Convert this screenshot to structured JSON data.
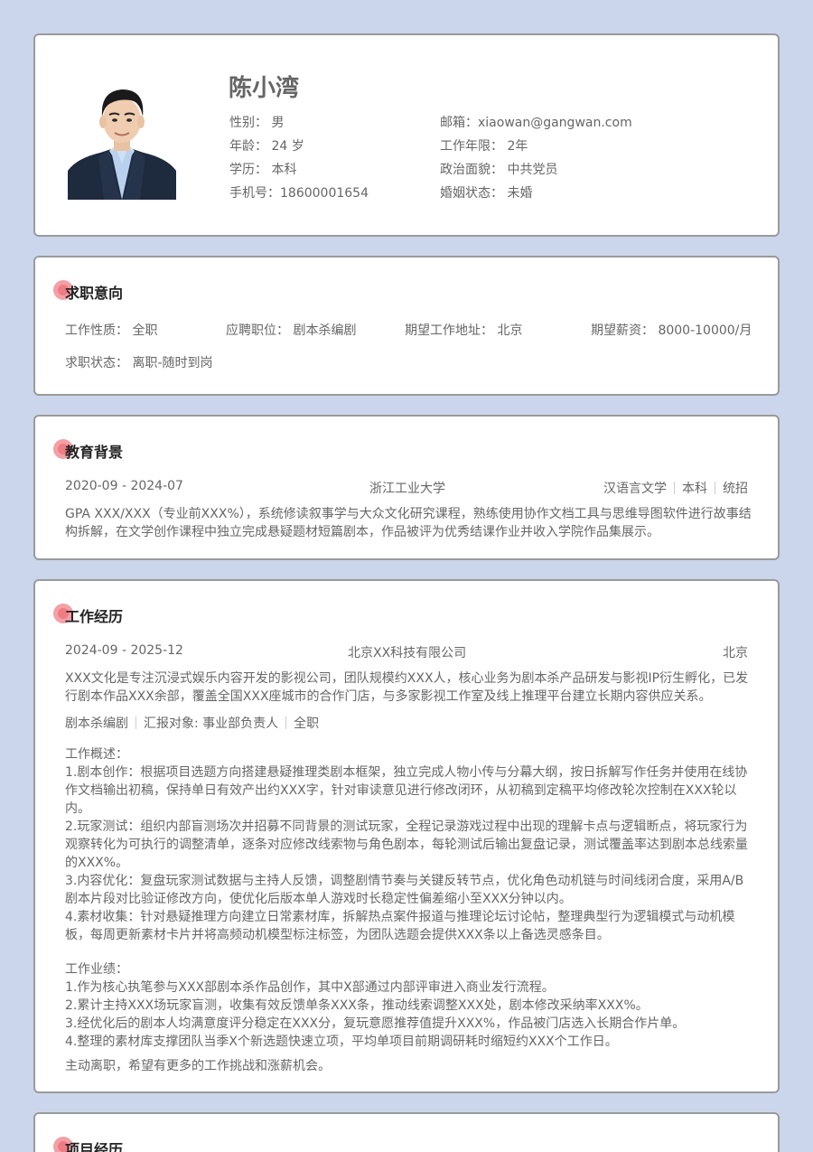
{
  "profile": {
    "name": "陈小湾",
    "gender_label": "性别：",
    "gender": "男",
    "age_label": "年龄：",
    "age": "24 岁",
    "edu_label": "学历：",
    "edu": "本科",
    "phone_label": "手机号：",
    "phone": "18600001654",
    "email_label": "邮箱：",
    "email": "xiaowan@gangwan.com",
    "years_label": "工作年限：",
    "years": "2年",
    "politics_label": "政治面貌：",
    "politics": "中共党员",
    "marital_label": "婚姻状态：",
    "marital": "未婚"
  },
  "intent": {
    "title": "求职意向",
    "type_label": "工作性质：",
    "type": "全职",
    "position_label": "应聘职位：",
    "position": "剧本杀编剧",
    "location_label": "期望工作地址：",
    "location": "北京",
    "salary_label": "期望薪资：",
    "salary": "8000-10000/月",
    "status_label": "求职状态：",
    "status": "离职-随时到岗"
  },
  "education": {
    "title": "教育背景",
    "period": "2020-09 - 2024-07",
    "school": "浙江工业大学",
    "major": "汉语言文学",
    "degree": "本科",
    "mode": "统招",
    "desc": "GPA XXX/XXX（专业前XXX%），系统修读叙事学与大众文化研究课程，熟练使用协作文档工具与思维导图软件进行故事结构拆解，在文学创作课程中独立完成悬疑题材短篇剧本，作品被评为优秀结课作业并收入学院作品集展示。"
  },
  "work": {
    "title": "工作经历",
    "period": "2024-09 - 2025-12",
    "company": "北京XX科技有限公司",
    "city": "北京",
    "company_desc": "XXX文化是专注沉浸式娱乐内容开发的影视公司，团队规模约XXX人，核心业务为剧本杀产品研发与影视IP衍生孵化，已发行剧本作品XXX余部，覆盖全国XXX座城市的合作门店，与多家影视工作室及线上推理平台建立长期内容供应关系。",
    "role": "剧本杀编剧",
    "report": "汇报对象: 事业部负责人",
    "job_type": "全职",
    "overview_label": "工作概述：",
    "overview": [
      "1.剧本创作：根据项目选题方向搭建悬疑推理类剧本框架，独立完成人物小传与分幕大纲，按日拆解写作任务并使用在线协作文档输出初稿，保持单日有效产出约XXX字，针对审读意见进行修改闭环，从初稿到定稿平均修改轮次控制在XXX轮以内。",
      "2.玩家测试：组织内部盲测场次并招募不同背景的测试玩家，全程记录游戏过程中出现的理解卡点与逻辑断点，将玩家行为观察转化为可执行的调整清单，逐条对应修改线索物与角色剧本，每轮测试后输出复盘记录，测试覆盖率达到剧本总线索量的XXX%。",
      "3.内容优化：复盘玩家测试数据与主持人反馈，调整剧情节奏与关键反转节点，优化角色动机链与时间线闭合度，采用A/B剧本片段对比验证修改方向，使优化后版本单人游戏时长稳定性偏差缩小至XXX分钟以内。",
      "4.素材收集：针对悬疑推理方向建立日常素材库，拆解热点案件报道与推理论坛讨论帖，整理典型行为逻辑模式与动机模板，每周更新素材卡片并将高频动机模型标注标签，为团队选题会提供XXX条以上备选灵感条目。"
    ],
    "results_label": "工作业绩：",
    "results": [
      "1.作为核心执笔参与XXX部剧本杀作品创作，其中X部通过内部评审进入商业发行流程。",
      "2.累计主持XXX场玩家盲测，收集有效反馈单条XXX条，推动线索调整XXX处，剧本修改采纳率XXX%。",
      "3.经优化后的剧本人均满意度评分稳定在XXX分，复玩意愿推荐值提升XXX%，作品被门店选入长期合作片单。",
      "4.整理的素材库支撑团队当季X个新选题快速立项，平均单项目前期调研耗时缩短约XXX个工作日。"
    ],
    "leave_reason": "主动离职，希望有更多的工作挑战和涨薪机会。"
  },
  "project": {
    "title": "项目经历"
  }
}
